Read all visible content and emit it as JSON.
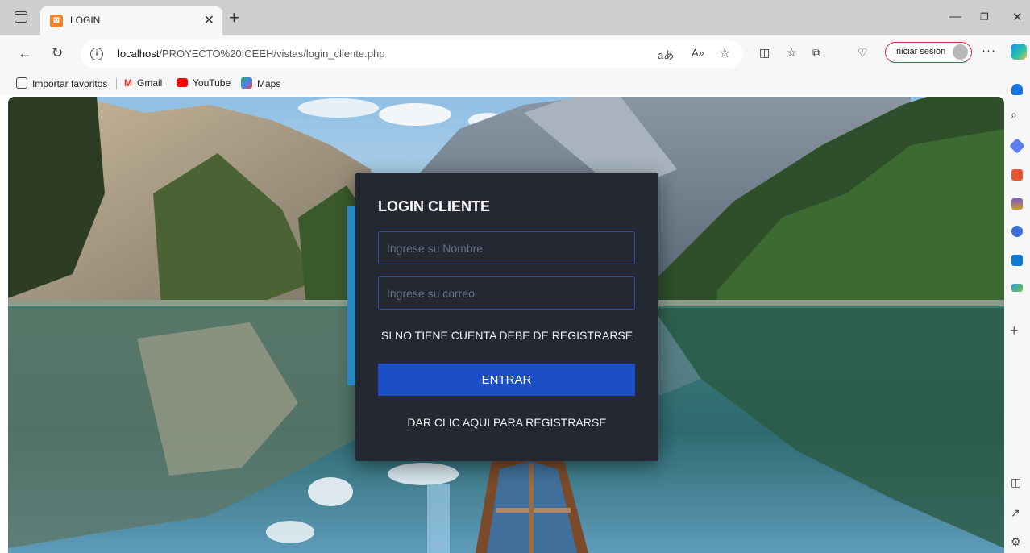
{
  "browser": {
    "tab_title": "LOGIN",
    "tab_favicon": "⊠",
    "url_host": "localhost",
    "url_path": "/PROYECTO%20ICEEH/vistas/login_cliente.php",
    "signin_label": "Iniciar sesión",
    "favorites": [
      {
        "label": "Importar favoritos",
        "icon": "import-favorites-icon",
        "color": "#444444"
      },
      {
        "label": "Gmail",
        "icon": "gmail-icon",
        "color": "#d93025"
      },
      {
        "label": "YouTube",
        "icon": "youtube-icon",
        "color": "#ff0000"
      },
      {
        "label": "Maps",
        "icon": "maps-icon",
        "color": "#34a853"
      }
    ]
  },
  "login": {
    "title": "LOGIN CLIENTE",
    "name_placeholder": "Ingrese su Nombre",
    "email_placeholder": "Ingrese su correo",
    "info_text": "SI NO TIENE CUENTA DEBE DE REGISTRARSE",
    "submit_label": "ENTRAR",
    "register_link": "DAR CLIC AQUI PARA REGISTRARSE"
  },
  "colors": {
    "card_bg": "#232833",
    "accent": "#2a86c2",
    "button": "#1d4fc4",
    "input_border": "#3150b8"
  }
}
